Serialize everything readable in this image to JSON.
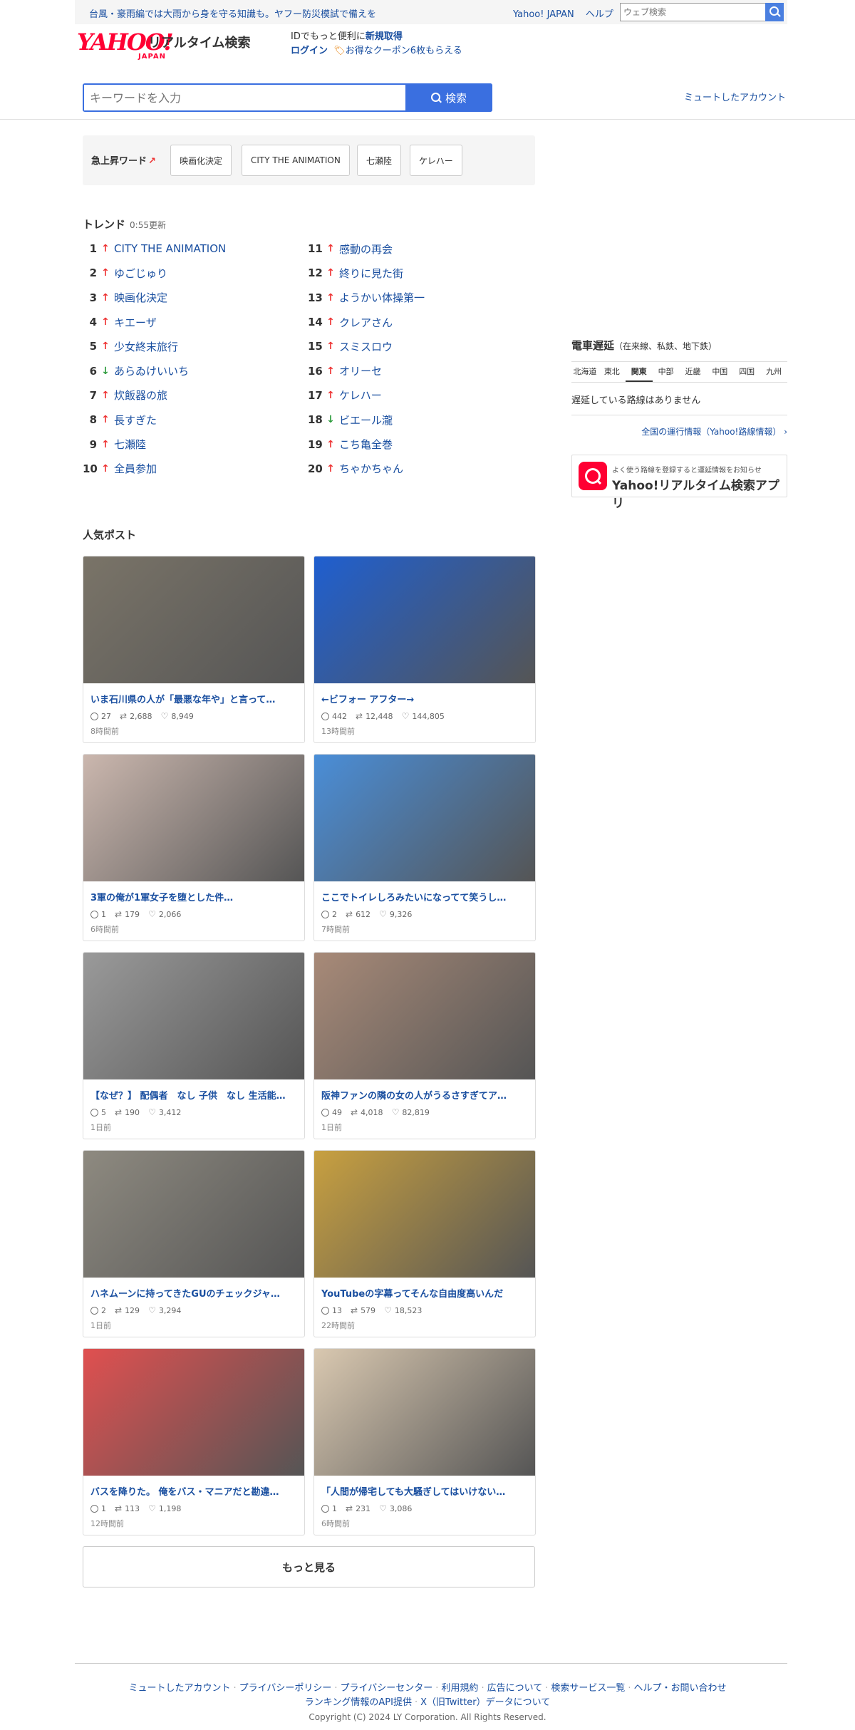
{
  "topbar": {
    "notice": "台風・豪雨編では大雨から身を守る知識も。ヤフー防災模試で備えを",
    "links": [
      "Yahoo! JAPAN",
      "ヘルプ"
    ],
    "web_search_placeholder": "ウェブ検索"
  },
  "header": {
    "logo_main": "YAHOO!",
    "logo_sub": "JAPAN",
    "service_name": "リアルタイム検索",
    "id_text": "IDでもっと便利に",
    "id_link": "新規取得",
    "login": "ログイン",
    "coupon": "お得なクーポン6枚もらえる",
    "muted_account": "ミュートしたアカウント"
  },
  "search": {
    "placeholder": "キーワードを入力",
    "button": "検索"
  },
  "rising": {
    "label": "急上昇ワード",
    "words": [
      "映画化決定",
      "CITY THE ANIMATION",
      "七瀬陸",
      "ケレハー"
    ]
  },
  "trend": {
    "title": "トレンド",
    "updated": "0:55更新",
    "items": [
      {
        "rank": "1",
        "dir": "up",
        "word": "CITY THE ANIMATION"
      },
      {
        "rank": "2",
        "dir": "up",
        "word": "ゆごじゅり"
      },
      {
        "rank": "3",
        "dir": "up",
        "word": "映画化決定"
      },
      {
        "rank": "4",
        "dir": "up",
        "word": "キエーザ"
      },
      {
        "rank": "5",
        "dir": "up",
        "word": "少女終末旅行"
      },
      {
        "rank": "6",
        "dir": "down",
        "word": "あらゐけいいち"
      },
      {
        "rank": "7",
        "dir": "up",
        "word": "炊飯器の旅"
      },
      {
        "rank": "8",
        "dir": "up",
        "word": "長すぎた"
      },
      {
        "rank": "9",
        "dir": "up",
        "word": "七瀬陸"
      },
      {
        "rank": "10",
        "dir": "up",
        "word": "全員参加"
      },
      {
        "rank": "11",
        "dir": "up",
        "word": "感動の再会"
      },
      {
        "rank": "12",
        "dir": "up",
        "word": "終りに見た街"
      },
      {
        "rank": "13",
        "dir": "up",
        "word": "ようかい体操第一"
      },
      {
        "rank": "14",
        "dir": "up",
        "word": "クレアさん"
      },
      {
        "rank": "15",
        "dir": "up",
        "word": "スミスロウ"
      },
      {
        "rank": "16",
        "dir": "up",
        "word": "オリーセ"
      },
      {
        "rank": "17",
        "dir": "up",
        "word": "ケレハー"
      },
      {
        "rank": "18",
        "dir": "down",
        "word": "ビエール瀧"
      },
      {
        "rank": "19",
        "dir": "up",
        "word": "こち亀全巻"
      },
      {
        "rank": "20",
        "dir": "up",
        "word": "ちゃかちゃん"
      }
    ]
  },
  "posts": {
    "title": "人気ポスト",
    "items": [
      {
        "title": "いま石川県の人が「最悪な年や」と言って…",
        "replies": "27",
        "reposts": "2,688",
        "likes": "8,949",
        "time": "8時間前",
        "bg": "#7a7468"
      },
      {
        "title": "←ビフォー アフター→",
        "replies": "442",
        "reposts": "12,448",
        "likes": "144,805",
        "time": "13時間前",
        "bg": "#1f5fd0"
      },
      {
        "title": "3軍の俺が1軍女子を堕とした件…",
        "replies": "1",
        "reposts": "179",
        "likes": "2,066",
        "time": "6時間前",
        "bg": "#cbb7ae"
      },
      {
        "title": "ここでトイレしろみたいになってて笑うし…",
        "replies": "2",
        "reposts": "612",
        "likes": "9,326",
        "time": "7時間前",
        "bg": "#4a8ed8"
      },
      {
        "title": "【なぜ？】 配偶者　なし 子供　なし 生活能…",
        "replies": "5",
        "reposts": "190",
        "likes": "3,412",
        "time": "1日前",
        "bg": "#9a9a9a"
      },
      {
        "title": "阪神ファンの隣の女の人がうるさすぎてア…",
        "replies": "49",
        "reposts": "4,018",
        "likes": "82,819",
        "time": "1日前",
        "bg": "#a88a78"
      },
      {
        "title": "ハネムーンに持ってきたGUのチェックジャ…",
        "replies": "2",
        "reposts": "129",
        "likes": "3,294",
        "time": "1日前",
        "bg": "#8e8a80"
      },
      {
        "title": "YouTubeの字幕ってそんな自由度高いんだ",
        "replies": "13",
        "reposts": "579",
        "likes": "18,523",
        "time": "22時間前",
        "bg": "#c8a040"
      },
      {
        "title": "バスを降りた。 俺をバス・マニアだと勘違…",
        "replies": "1",
        "reposts": "113",
        "likes": "1,198",
        "time": "12時間前",
        "bg": "#e05050"
      },
      {
        "title": "「人間が帰宅しても大騒ぎしてはいけない…",
        "replies": "1",
        "reposts": "231",
        "likes": "3,086",
        "time": "6時間前",
        "bg": "#d9c8b0"
      }
    ],
    "more": "もっと見る"
  },
  "train": {
    "title": "電車遅延",
    "subtitle": "（在来線、私鉄、地下鉄）",
    "regions": [
      "北海道",
      "東北",
      "関東",
      "中部",
      "近畿",
      "中国",
      "四国",
      "九州"
    ],
    "active_region": "関東",
    "status": "遅延している路線はありません",
    "link": "全国の運行情報（Yahoo!路線情報）"
  },
  "app": {
    "sub": "よく使う路線を登録すると運延情報をお知らせ",
    "main": "Yahoo!リアルタイム検索アプリ"
  },
  "footer": {
    "links1": [
      "ミュートしたアカウント",
      "プライバシーポリシー",
      "プライバシーセンター",
      "利用規約",
      "広告について",
      "検索サービス一覧",
      "ヘルプ・お問い合わせ"
    ],
    "links2": [
      "ランキング情報のAPI提供",
      "X（旧Twitter）データについて"
    ],
    "copyright": "Copyright (C) 2024 LY Corporation. All Rights Reserved."
  },
  "colors": {
    "link": "#1a4fa0",
    "accent": "#3a6fe0",
    "up": "#e33",
    "down": "#2a9a3a",
    "brand": "#ff0033"
  }
}
